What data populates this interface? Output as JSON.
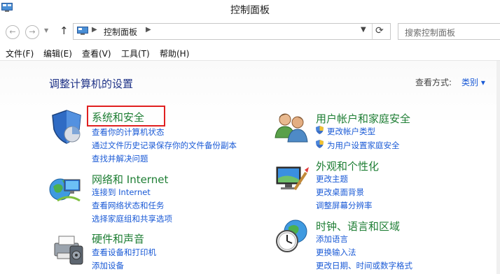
{
  "window": {
    "title": "控制面板"
  },
  "nav": {
    "back": "←",
    "forward": "→",
    "up": "↑",
    "address_breadcrumb": "控制面板",
    "search_placeholder": "搜索控制面板"
  },
  "menu": [
    "文件(F)",
    "编辑(E)",
    "查看(V)",
    "工具(T)",
    "帮助(H)"
  ],
  "main": {
    "heading": "调整计算机的设置",
    "view_by_label": "查看方式:",
    "view_by_value": "类别 ▾"
  },
  "categories": [
    {
      "title": "系统和安全",
      "icon": "shield-icon",
      "links": [
        "查看你的计算机状态",
        "通过文件历史记录保存你的文件备份副本",
        "查找并解决问题"
      ]
    },
    {
      "title": "网络和 Internet",
      "icon": "globe-network-icon",
      "links": [
        "连接到 Internet",
        "查看网络状态和任务",
        "选择家庭组和共享选项"
      ]
    },
    {
      "title": "硬件和声音",
      "icon": "printer-icon",
      "links": [
        "查看设备和打印机",
        "添加设备"
      ]
    },
    {
      "title": "用户帐户和家庭安全",
      "icon": "users-icon",
      "links": [
        "更改帐户类型",
        "为用户设置家庭安全"
      ]
    },
    {
      "title": "外观和个性化",
      "icon": "monitor-icon",
      "links": [
        "更改主题",
        "更改桌面背景",
        "调整屏幕分辨率"
      ]
    },
    {
      "title": "时钟、语言和区域",
      "icon": "clock-globe-icon",
      "links": [
        "添加语言",
        "更换输入法",
        "更改日期、时间或数字格式"
      ]
    }
  ],
  "colors": {
    "category_title": "#1e7e34",
    "link": "#1a5ad6",
    "heading": "#1e3287",
    "highlight": "#e02020"
  }
}
